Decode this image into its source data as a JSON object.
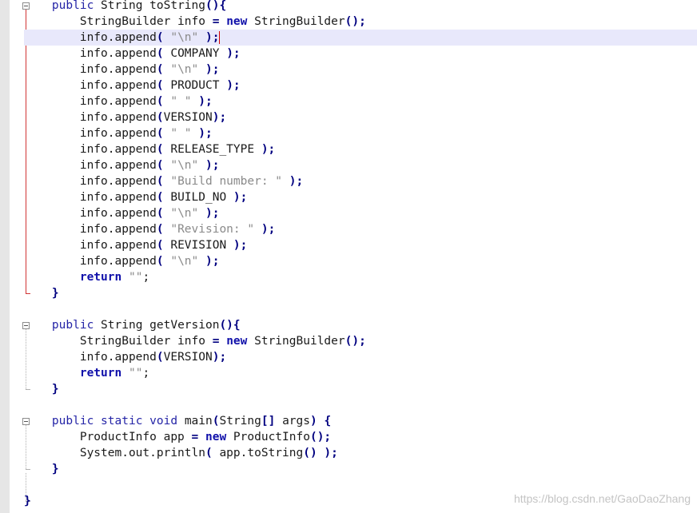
{
  "editor": {
    "lines": [
      {
        "indent": 1,
        "tokens": [
          {
            "t": "public",
            "c": "kw"
          },
          {
            "t": " String toString"
          },
          {
            "t": "(){",
            "c": "op"
          }
        ]
      },
      {
        "indent": 2,
        "tokens": [
          {
            "t": "StringBuilder info "
          },
          {
            "t": "=",
            "c": "op"
          },
          {
            "t": " "
          },
          {
            "t": "new",
            "c": "kb"
          },
          {
            "t": " StringBuilder"
          },
          {
            "t": "();",
            "c": "op"
          }
        ]
      },
      {
        "indent": 2,
        "current": true,
        "tokens": [
          {
            "t": "info.append"
          },
          {
            "t": "(",
            "c": "op"
          },
          {
            "t": " "
          },
          {
            "t": "\"\\n\"",
            "c": "str"
          },
          {
            "t": " "
          },
          {
            "t": ");",
            "c": "op"
          }
        ]
      },
      {
        "indent": 2,
        "tokens": [
          {
            "t": "info.append"
          },
          {
            "t": "(",
            "c": "op"
          },
          {
            "t": " COMPANY "
          },
          {
            "t": ");",
            "c": "op"
          }
        ]
      },
      {
        "indent": 2,
        "tokens": [
          {
            "t": "info.append"
          },
          {
            "t": "(",
            "c": "op"
          },
          {
            "t": " "
          },
          {
            "t": "\"\\n\"",
            "c": "str"
          },
          {
            "t": " "
          },
          {
            "t": ");",
            "c": "op"
          }
        ]
      },
      {
        "indent": 2,
        "tokens": [
          {
            "t": "info.append"
          },
          {
            "t": "(",
            "c": "op"
          },
          {
            "t": " PRODUCT "
          },
          {
            "t": ");",
            "c": "op"
          }
        ]
      },
      {
        "indent": 2,
        "tokens": [
          {
            "t": "info.append"
          },
          {
            "t": "(",
            "c": "op"
          },
          {
            "t": " "
          },
          {
            "t": "\" \"",
            "c": "str"
          },
          {
            "t": " "
          },
          {
            "t": ");",
            "c": "op"
          }
        ]
      },
      {
        "indent": 2,
        "tokens": [
          {
            "t": "info.append"
          },
          {
            "t": "(",
            "c": "op"
          },
          {
            "t": "VERSION"
          },
          {
            "t": ");",
            "c": "op"
          }
        ]
      },
      {
        "indent": 2,
        "tokens": [
          {
            "t": "info.append"
          },
          {
            "t": "(",
            "c": "op"
          },
          {
            "t": " "
          },
          {
            "t": "\" \"",
            "c": "str"
          },
          {
            "t": " "
          },
          {
            "t": ");",
            "c": "op"
          }
        ]
      },
      {
        "indent": 2,
        "tokens": [
          {
            "t": "info.append"
          },
          {
            "t": "(",
            "c": "op"
          },
          {
            "t": " RELEASE_TYPE "
          },
          {
            "t": ");",
            "c": "op"
          }
        ]
      },
      {
        "indent": 2,
        "tokens": [
          {
            "t": "info.append"
          },
          {
            "t": "(",
            "c": "op"
          },
          {
            "t": " "
          },
          {
            "t": "\"\\n\"",
            "c": "str"
          },
          {
            "t": " "
          },
          {
            "t": ");",
            "c": "op"
          }
        ]
      },
      {
        "indent": 2,
        "tokens": [
          {
            "t": "info.append"
          },
          {
            "t": "(",
            "c": "op"
          },
          {
            "t": " "
          },
          {
            "t": "\"Build number: \"",
            "c": "str"
          },
          {
            "t": " "
          },
          {
            "t": ");",
            "c": "op"
          }
        ]
      },
      {
        "indent": 2,
        "tokens": [
          {
            "t": "info.append"
          },
          {
            "t": "(",
            "c": "op"
          },
          {
            "t": " BUILD_NO "
          },
          {
            "t": ");",
            "c": "op"
          }
        ]
      },
      {
        "indent": 2,
        "tokens": [
          {
            "t": "info.append"
          },
          {
            "t": "(",
            "c": "op"
          },
          {
            "t": " "
          },
          {
            "t": "\"\\n\"",
            "c": "str"
          },
          {
            "t": " "
          },
          {
            "t": ");",
            "c": "op"
          }
        ]
      },
      {
        "indent": 2,
        "tokens": [
          {
            "t": "info.append"
          },
          {
            "t": "(",
            "c": "op"
          },
          {
            "t": " "
          },
          {
            "t": "\"Revision: \"",
            "c": "str"
          },
          {
            "t": " "
          },
          {
            "t": ");",
            "c": "op"
          }
        ]
      },
      {
        "indent": 2,
        "tokens": [
          {
            "t": "info.append"
          },
          {
            "t": "(",
            "c": "op"
          },
          {
            "t": " REVISION "
          },
          {
            "t": ");",
            "c": "op"
          }
        ]
      },
      {
        "indent": 2,
        "tokens": [
          {
            "t": "info.append"
          },
          {
            "t": "(",
            "c": "op"
          },
          {
            "t": " "
          },
          {
            "t": "\"\\n\"",
            "c": "str"
          },
          {
            "t": " "
          },
          {
            "t": ");",
            "c": "op"
          }
        ]
      },
      {
        "indent": 2,
        "tokens": [
          {
            "t": "return",
            "c": "kb"
          },
          {
            "t": " "
          },
          {
            "t": "\"\"",
            "c": "str"
          },
          {
            "t": ";"
          }
        ]
      },
      {
        "indent": 1,
        "tokens": [
          {
            "t": "}",
            "c": "op"
          }
        ]
      },
      {
        "indent": 0,
        "tokens": []
      },
      {
        "indent": 1,
        "tokens": [
          {
            "t": "public",
            "c": "kw"
          },
          {
            "t": " String getVersion"
          },
          {
            "t": "(){",
            "c": "op"
          }
        ]
      },
      {
        "indent": 2,
        "tokens": [
          {
            "t": "StringBuilder info "
          },
          {
            "t": "=",
            "c": "op"
          },
          {
            "t": " "
          },
          {
            "t": "new",
            "c": "kb"
          },
          {
            "t": " StringBuilder"
          },
          {
            "t": "();",
            "c": "op"
          }
        ]
      },
      {
        "indent": 2,
        "tokens": [
          {
            "t": "info.append"
          },
          {
            "t": "(",
            "c": "op"
          },
          {
            "t": "VERSION"
          },
          {
            "t": ");",
            "c": "op"
          }
        ]
      },
      {
        "indent": 2,
        "tokens": [
          {
            "t": "return",
            "c": "kb"
          },
          {
            "t": " "
          },
          {
            "t": "\"\"",
            "c": "str"
          },
          {
            "t": ";"
          }
        ]
      },
      {
        "indent": 1,
        "tokens": [
          {
            "t": "}",
            "c": "op"
          }
        ]
      },
      {
        "indent": 0,
        "tokens": []
      },
      {
        "indent": 1,
        "tokens": [
          {
            "t": "public",
            "c": "kw"
          },
          {
            "t": " "
          },
          {
            "t": "static",
            "c": "kw"
          },
          {
            "t": " "
          },
          {
            "t": "void",
            "c": "kw"
          },
          {
            "t": " main"
          },
          {
            "t": "(",
            "c": "op"
          },
          {
            "t": "String"
          },
          {
            "t": "[]",
            "c": "op"
          },
          {
            "t": " args"
          },
          {
            "t": ")",
            "c": "op"
          },
          {
            "t": " "
          },
          {
            "t": "{",
            "c": "op"
          }
        ]
      },
      {
        "indent": 2,
        "tokens": [
          {
            "t": "ProductInfo app "
          },
          {
            "t": "=",
            "c": "op"
          },
          {
            "t": " "
          },
          {
            "t": "new",
            "c": "kb"
          },
          {
            "t": " ProductInfo"
          },
          {
            "t": "();",
            "c": "op"
          }
        ]
      },
      {
        "indent": 2,
        "tokens": [
          {
            "t": "System.out.println"
          },
          {
            "t": "(",
            "c": "op"
          },
          {
            "t": " app.toString"
          },
          {
            "t": "()",
            "c": "op"
          },
          {
            "t": " "
          },
          {
            "t": ");",
            "c": "op"
          }
        ]
      },
      {
        "indent": 1,
        "tokens": [
          {
            "t": "}",
            "c": "op"
          }
        ]
      },
      {
        "indent": 0,
        "tokens": []
      },
      {
        "indent": 0,
        "tokens": [
          {
            "t": "}",
            "c": "op"
          }
        ]
      }
    ]
  },
  "watermark": "https://blog.csdn.net/GaoDaoZhang",
  "colors": {
    "keyword": "#2525a7",
    "bold_keyword": "#1010aa",
    "operator": "#000080",
    "string": "#8a8a8a",
    "current_line": "#e8e8fb",
    "modified_marker": "#d13434"
  }
}
